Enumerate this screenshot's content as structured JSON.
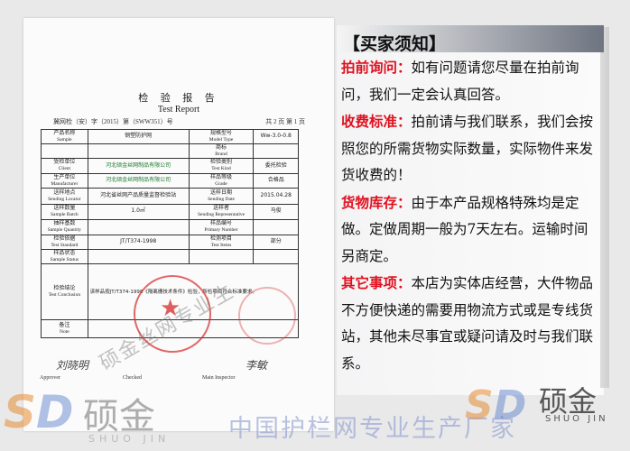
{
  "certificate": {
    "title_cn": "检 验 报 告",
    "title_en": "Test Report",
    "report_no": "冀网检（安）字（2015）第（SWW351）号",
    "page_info": "共 2 页  第 1 页",
    "rows": [
      {
        "label_cn": "产品名称",
        "label_en": "Sample",
        "value": "钢塑防护网",
        "label2_cn": "规格型号",
        "label2_en": "Model Type",
        "value2": "Ww-3.0-0.8"
      },
      {
        "label_cn": "",
        "label_en": "",
        "value": "",
        "label2_cn": "商标",
        "label2_en": "Brand",
        "value2": ""
      },
      {
        "label_cn": "受检单位",
        "label_en": "Client",
        "value": "河北硕金丝网制品有限公司",
        "label2_cn": "检验类别",
        "label2_en": "Test Kind",
        "value2": "委托检验"
      },
      {
        "label_cn": "生产单位",
        "label_en": "Manufacturer",
        "value": "河北硕金丝网制品有限公司",
        "label2_cn": "样品等级",
        "label2_en": "Grade",
        "value2": "合格品"
      },
      {
        "label_cn": "送样地点",
        "label_en": "Sending Locator",
        "value": "河北省丝网产品质量监督检验站",
        "label2_cn": "送样日期",
        "label2_en": "Sending Date",
        "value2": "2015.04.28"
      },
      {
        "label_cn": "送样数量",
        "label_en": "Sample Batch",
        "value": "1.0㎡",
        "label2_cn": "送样者",
        "label2_en": "Sending Representative",
        "value2": "马俊"
      },
      {
        "label_cn": "抽样基数",
        "label_en": "Sample Quantity",
        "value": "",
        "label2_cn": "样品编号",
        "label2_en": "Primary Number",
        "value2": ""
      },
      {
        "label_cn": "检验依据",
        "label_en": "Test Standard",
        "value": "JT/T374-1998",
        "label2_cn": "检测项目",
        "label2_en": "Test Items",
        "value2": "部分"
      },
      {
        "label_cn": "样品状态",
        "label_en": "Sample Status",
        "value": "",
        "label2_cn": "",
        "label2_en": "",
        "value2": ""
      }
    ],
    "conclusion_label_cn": "检验结论",
    "conclusion_label_en": "Test Conclusion",
    "conclusion_text": "该样品按JT/T374-1998《隔离栅技术条件》检验，所检项目符合标准要求。",
    "remark_label_cn": "备注",
    "remark_label_en": "Note",
    "approver_label": "Approver",
    "checker_label": "Checked",
    "inspector_label": "Main Inspector",
    "sig1": "刘晓明",
    "sig2": "李敏",
    "doc_watermark": "硕金丝网专业生"
  },
  "notice": {
    "title": "买家须知",
    "bracket_left": "【",
    "bracket_right": "】",
    "items": [
      {
        "key": "拍前询问：",
        "text": "如有问题请您尽量在拍前询问，我们一定会认真回答。"
      },
      {
        "key": "收费标准：",
        "text": "拍前请与我们联系，我们会按照您的所需货物实际数量，实际物件来发货收费的！"
      },
      {
        "key": "货物库存：",
        "text": "由于本产品规格特殊均是定做。定做周期一般为7天左右。运输时间另商定。"
      },
      {
        "key": "其它事项：",
        "text": "本店为实体店经营，大件物品不方便快递的需要用物流方式或是专线货站，其他未尽事宜或疑问请及时与我们联系。"
      }
    ]
  },
  "watermark": {
    "brand_cn": "硕金",
    "brand_en": "SHUO JIN",
    "slogan": "中国护栏网专业生产厂家",
    "logo": "SD"
  },
  "colors": {
    "key_red": "#e0101f",
    "header_gradient_end": "#6e7480",
    "stamp_red": "#d62828"
  }
}
